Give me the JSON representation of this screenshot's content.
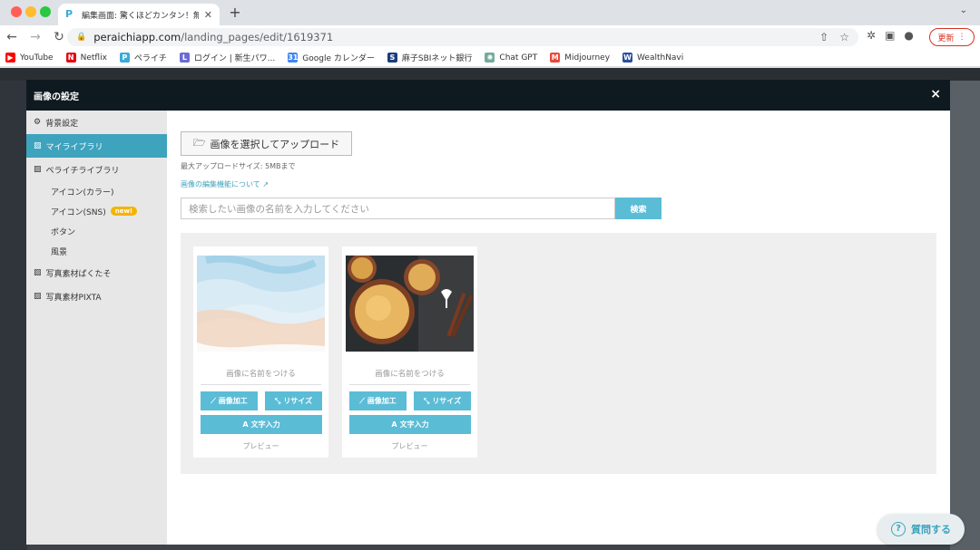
{
  "browser": {
    "tab_title": "編集画面: 驚くほどカンタン！無料",
    "url_host": "peraichiapp.com",
    "url_path": "/landing_pages/edit/1619371",
    "update_label": "更新",
    "bookmarks": [
      {
        "label": "YouTube",
        "icon": "youtube-icon",
        "color": "#ff0000"
      },
      {
        "label": "Netflix",
        "icon": "netflix-icon",
        "color": "#e50914"
      },
      {
        "label": "ペライチ",
        "icon": "peraichi-icon",
        "color": "#3ba9d9"
      },
      {
        "label": "ログイン | 新生パワ...",
        "icon": "login-icon",
        "color": "#6b6bd6"
      },
      {
        "label": "Google カレンダー",
        "icon": "calendar-icon",
        "color": "#4285f4"
      },
      {
        "label": "麻子SBIネット銀行",
        "icon": "bank-icon",
        "color": "#1a3d7c"
      },
      {
        "label": "Chat GPT",
        "icon": "chatgpt-icon",
        "color": "#74aa9c"
      },
      {
        "label": "Midjourney",
        "icon": "midjourney-icon",
        "color": "#e84a3a"
      },
      {
        "label": "WealthNavi",
        "icon": "wealthnavi-icon",
        "color": "#2a4ea0"
      }
    ]
  },
  "modal": {
    "title": "画像の設定",
    "close": "×"
  },
  "sidebar": {
    "items": [
      {
        "label": "背景設定",
        "icon": "gear-icon"
      },
      {
        "label": "マイライブラリ",
        "icon": "image-icon",
        "active": true
      },
      {
        "label": "ペライチライブラリ",
        "icon": "image-icon"
      },
      {
        "label": "アイコン(カラー)"
      },
      {
        "label": "アイコン(SNS)",
        "badge": "new!"
      },
      {
        "label": "ボタン"
      },
      {
        "label": "風景"
      },
      {
        "label": "写真素材ぱくたそ",
        "icon": "image-icon"
      },
      {
        "label": "写真素材PIXTA",
        "icon": "image-icon"
      }
    ]
  },
  "main": {
    "upload_label": "画像を選択してアップロード",
    "max_size": "最大アップロードサイズ: 5MBまで",
    "edit_link": "画像の編集機能について",
    "search_placeholder": "検索したい画像の名前を入力してください",
    "search_button": "検索"
  },
  "cards": [
    {
      "name_prompt": "画像に名前をつける",
      "edit": "画像加工",
      "resize": "リサイズ",
      "text": "文字入力",
      "preview": "プレビュー"
    },
    {
      "name_prompt": "画像に名前をつける",
      "edit": "画像加工",
      "resize": "リサイズ",
      "text": "文字入力",
      "preview": "プレビュー"
    }
  ],
  "help": {
    "label": "質問する"
  },
  "colors": {
    "accent": "#3ea3bd",
    "button": "#5bbcd6",
    "header": "#0f1a20"
  }
}
